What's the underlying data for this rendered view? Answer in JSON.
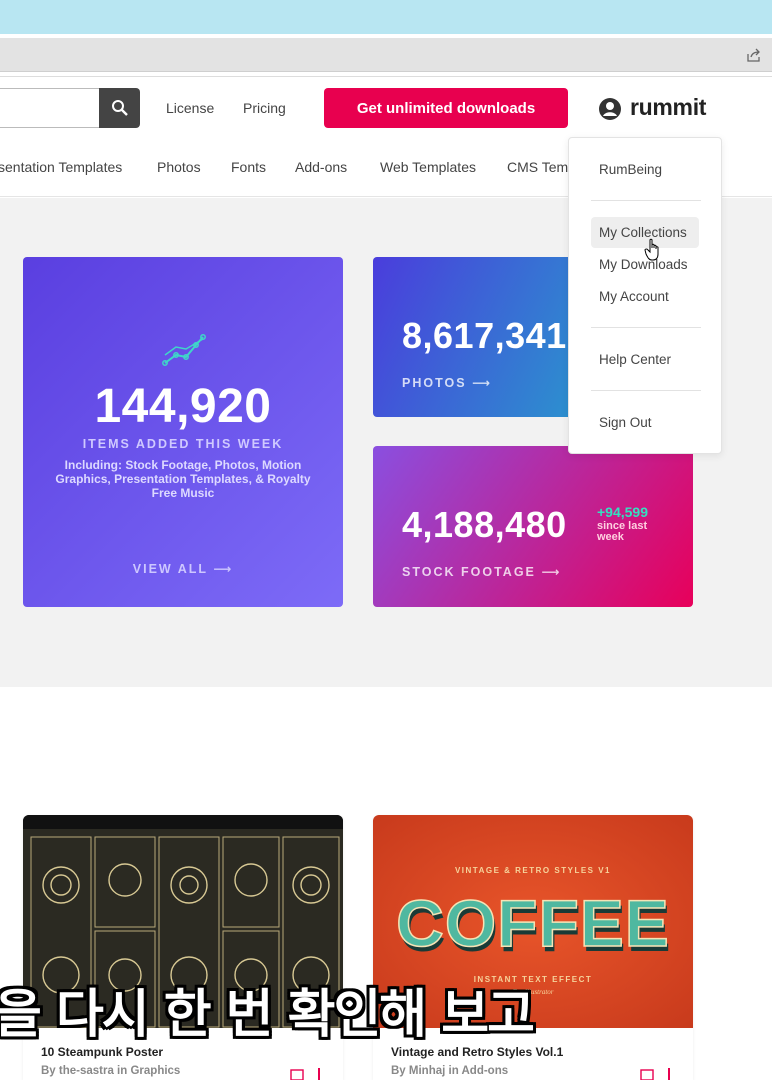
{
  "header": {
    "nav": {
      "license": "License",
      "pricing": "Pricing"
    },
    "cta_label": "Get unlimited downloads",
    "brand": "rummit"
  },
  "categories": [
    "sentation Templates",
    "Photos",
    "Fonts",
    "Add-ons",
    "Web Templates",
    "CMS Temp"
  ],
  "stats": {
    "main": {
      "value": "144,920",
      "label": "ITEMS ADDED THIS WEEK",
      "description": "Including: Stock Footage, Photos, Motion Graphics, Presentation Templates, & Royalty Free Music",
      "link": "VIEW ALL ⟶"
    },
    "photos": {
      "value": "8,617,341",
      "label": "PHOTOS ⟶"
    },
    "footage": {
      "value": "4,188,480",
      "label": "STOCK FOOTAGE ⟶",
      "increase": "+94,599",
      "increase_sub": "since last week"
    }
  },
  "dropdown": {
    "username": "RumBeing",
    "items": [
      "My Collections",
      "My Downloads",
      "My Account"
    ],
    "help": "Help Center",
    "signout": "Sign Out"
  },
  "tiles": [
    {
      "title": "10 Steampunk Poster",
      "by": "By the-sastra in Graphics"
    },
    {
      "title": "Vintage and Retro Styles Vol.1",
      "by": "By Minhaj in Add-ons",
      "art_heading": "VINTAGE & RETRO STYLES V1",
      "art_word": "COFFEE",
      "art_sub": "INSTANT TEXT EFFECT",
      "art_sub2": "For Illustrator"
    }
  ],
  "subtitle": "을 다시 한 번 확인해 보고",
  "colors": {
    "cta": "#e8004f",
    "accent_teal": "#34e0c0"
  }
}
